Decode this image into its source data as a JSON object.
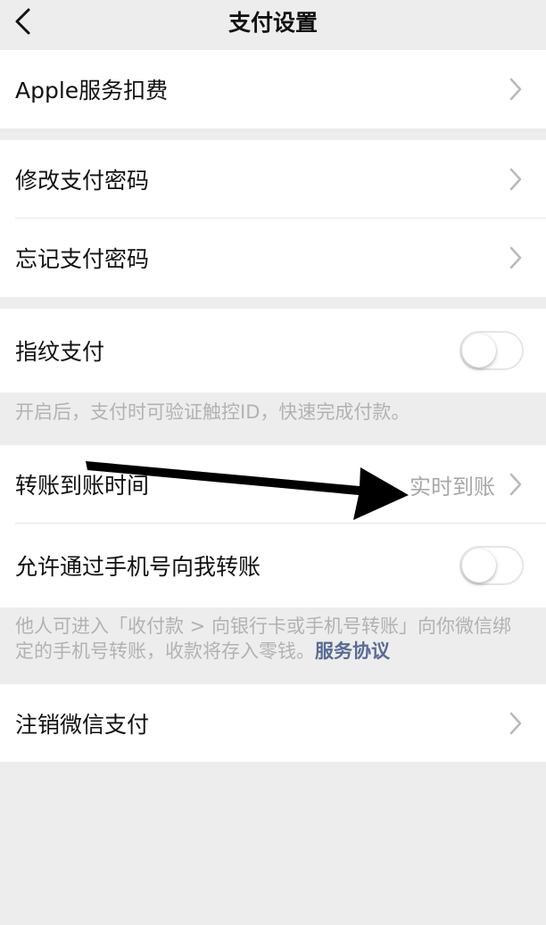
{
  "nav": {
    "title": "支付设置"
  },
  "group1": {
    "apple_label": "Apple服务扣费"
  },
  "group2": {
    "change_pwd_label": "修改支付密码",
    "forgot_pwd_label": "忘记支付密码"
  },
  "group3": {
    "fingerprint_label": "指纹支付",
    "fingerprint_enabled": false,
    "fingerprint_note": "开启后，支付时可验证触控ID，快速完成付款。"
  },
  "group4": {
    "transfer_time_label": "转账到账时间",
    "transfer_time_value": "实时到账",
    "phone_transfer_label": "允许通过手机号向我转账",
    "phone_transfer_enabled": false,
    "phone_note": "他人可进入「收付款 > 向银行卡或手机号转账」向你微信绑定的手机号转账，收款将存入零钱。",
    "phone_note_link": "服务协议"
  },
  "group5": {
    "cancel_label": "注销微信支付"
  },
  "colors": {
    "background": "#ededed",
    "link": "#576b95",
    "secondary_text": "#b2b2b2"
  },
  "icons": {
    "back": "chevron-left-icon",
    "row_chevron": "chevron-right-icon",
    "annotation": "black-arrow-annotation"
  }
}
